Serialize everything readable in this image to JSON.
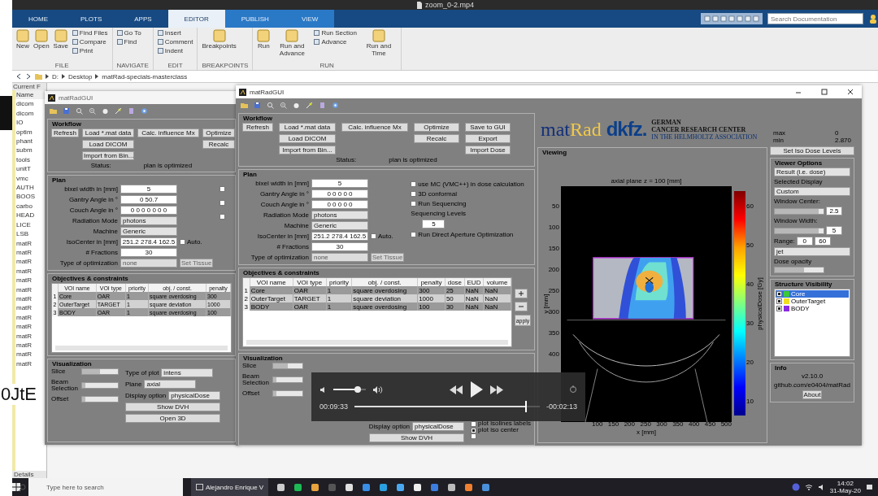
{
  "video_player": {
    "title": "zoom_0-2.mp4",
    "elapsed": "00:09:33",
    "remaining": "-00:02:13",
    "level": 0.93,
    "volume": {
      "level": 0.75
    }
  },
  "matlab": {
    "tabs": [
      {
        "label": "HOME",
        "selected": false
      },
      {
        "label": "PLOTS",
        "selected": false
      },
      {
        "label": "APPS",
        "selected": false
      },
      {
        "label": "EDITOR",
        "selected": true
      },
      {
        "label": "PUBLISH",
        "selected": false
      },
      {
        "label": "VIEW",
        "selected": false
      }
    ],
    "search": {
      "placeholder": "Search Documentation"
    },
    "ribbon": [
      {
        "label": "FILE",
        "items": [
          {
            "label": "New",
            "kind": "big"
          },
          {
            "label": "Open",
            "kind": "big"
          },
          {
            "label": "Save",
            "kind": "big"
          },
          {
            "label": "Find Files",
            "kind": "small"
          },
          {
            "label": "Compare",
            "kind": "small"
          },
          {
            "label": "Print",
            "kind": "small"
          }
        ]
      },
      {
        "label": "NAVIGATE",
        "items": [
          {
            "label": "Go To",
            "kind": "small"
          },
          {
            "label": "Find",
            "kind": "small"
          }
        ]
      },
      {
        "label": "EDIT",
        "items": [
          {
            "label": "Insert",
            "kind": "small"
          },
          {
            "label": "Comment",
            "kind": "small"
          },
          {
            "label": "Indent",
            "kind": "small"
          }
        ]
      },
      {
        "label": "BREAKPOINTS",
        "items": [
          {
            "label": "Breakpoints",
            "kind": "big"
          }
        ]
      },
      {
        "label": "RUN",
        "items": [
          {
            "label": "Run",
            "kind": "big"
          },
          {
            "label": "Run and Advance",
            "kind": "big"
          },
          {
            "label": "Run Section",
            "kind": "small"
          },
          {
            "label": "Advance",
            "kind": "small"
          },
          {
            "label": "Run and Time",
            "kind": "big"
          }
        ]
      }
    ],
    "path": [
      "D:",
      "Desktop",
      "matRad-specials-masterclass"
    ],
    "current_folder": {
      "title": "Current F",
      "items": [
        "Name",
        "dicom",
        "dicom",
        "IO",
        "optim",
        "phant",
        "subm",
        "tools",
        "unitT",
        "vmc",
        "AUTH",
        "BOOS",
        "carbo",
        "HEAD",
        "LICE",
        "LSB",
        "matR",
        "matR",
        "matR",
        "matR",
        "matR",
        "matR",
        "matR",
        "matR",
        "matR",
        "matR",
        "matR",
        "matR",
        "matR",
        "matR"
      ],
      "footer": "Details"
    },
    "side_text": "0JtE"
  },
  "background_gui": {
    "title": "matRadGUI",
    "workflow": {
      "title": "Workflow",
      "buttons": [
        "Refresh",
        "Load *.mat data",
        "Calc. influence Mx",
        "Optimize",
        "Load DICOM",
        "Recalc",
        "Import from Bin..."
      ],
      "status_label": "Status:",
      "status": "plan is optimized"
    },
    "plan": {
      "title": "Plan",
      "fields": [
        {
          "label": "bixel width in [mm]",
          "value": "5",
          "kind": "input"
        },
        {
          "label": "Gantry Angle in °",
          "value": "0 50.7",
          "kind": "input"
        },
        {
          "label": "Couch Angle in °",
          "value": "0 0 0 0 0 0 0",
          "kind": "input"
        },
        {
          "label": "Radiation Mode",
          "value": "photons",
          "kind": "popup"
        },
        {
          "label": "Machine",
          "value": "Generic",
          "kind": "popup"
        },
        {
          "label": "IsoCenter in [mm]",
          "value": "251.2 278.4 162.5",
          "kind": "input",
          "checkbox": {
            "label": "Auto.",
            "checked": false
          }
        },
        {
          "label": "# Fractions",
          "value": "30",
          "kind": "input"
        },
        {
          "label": "Type of optimization",
          "value": "none",
          "kind": "popup",
          "disabled": true,
          "button": {
            "label": "Set Tissue",
            "disabled": true
          }
        }
      ],
      "checks": [
        {
          "checked": false
        },
        {
          "checked": false
        },
        {
          "checked": false
        }
      ]
    },
    "objectives": {
      "title": "Objectives & constraints",
      "columns": [
        "",
        "VOI name",
        "VOI type",
        "priority",
        "obj. / const.",
        "penalty"
      ],
      "rows": [
        [
          "1",
          "Core",
          "OAR",
          "1",
          "square overdosing",
          "300"
        ],
        [
          "2",
          "OuterTarget",
          "TARGET",
          "1",
          "square deviation",
          "1000"
        ],
        [
          "3",
          "BODY",
          "OAR",
          "1",
          "square overdosing",
          "100"
        ]
      ]
    },
    "visualization": {
      "title": "Visualization",
      "sliders": [
        {
          "label": "Slice",
          "level": 0.5
        },
        {
          "label": "Beam Selection",
          "level": 0.1
        },
        {
          "label": "Offset",
          "level": 0.1
        }
      ],
      "popups": [
        {
          "label": "Type of plot",
          "value": "intens"
        },
        {
          "label": "Plane",
          "value": "axial"
        },
        {
          "label": "Display option",
          "value": "physicalDose"
        }
      ],
      "buttons": [
        "Show DVH",
        "Open 3D"
      ]
    }
  },
  "gui": {
    "title": "matRadGUI",
    "workflow": {
      "title": "Workflow",
      "buttons": [
        "Refresh",
        "Load *.mat data",
        "Calc. influence Mx",
        "Optimize",
        "Save to GUI",
        "Load DICOM",
        "Recalc",
        "Export",
        "Import from Bin...",
        "Import Dose"
      ],
      "status_label": "Status:",
      "status": "plan is optimized"
    },
    "plan": {
      "title": "Plan",
      "fields": [
        {
          "label": "bixel width in [mm]",
          "value": "5",
          "kind": "input"
        },
        {
          "label": "Gantry Angle in °",
          "value": "0 0 0 0 0",
          "kind": "input"
        },
        {
          "label": "Couch Angle in °",
          "value": "0 0 0 0 0",
          "kind": "input"
        },
        {
          "label": "Radiation Mode",
          "value": "photons",
          "kind": "popup"
        },
        {
          "label": "Machine",
          "value": "Generic",
          "kind": "popup"
        },
        {
          "label": "IsoCenter in [mm]",
          "value": "251.2 278.4 162.5",
          "kind": "input",
          "checkbox": {
            "label": "Auto.",
            "checked": false
          }
        },
        {
          "label": "# Fractions",
          "value": "30",
          "kind": "input"
        },
        {
          "label": "Type of optimization",
          "value": "none",
          "kind": "popup",
          "disabled": true,
          "button": {
            "label": "Set Tissue",
            "disabled": true
          }
        }
      ],
      "options": [
        {
          "kind": "checkbox",
          "label": "use MC (VMC++) in dose calculation",
          "checked": false
        },
        {
          "kind": "checkbox",
          "label": "3D conformal",
          "checked": false
        },
        {
          "kind": "checkbox",
          "label": "Run Sequencing",
          "checked": false
        },
        {
          "kind": "label",
          "label": "Sequencing Levels"
        },
        {
          "kind": "input",
          "value": "5"
        },
        {
          "kind": "checkbox",
          "label": "Run Direct Aperture Optimization",
          "checked": false
        }
      ]
    },
    "objectives": {
      "title": "Objectives & constraints",
      "columns": [
        "",
        "VOI name",
        "VOI type",
        "priority",
        "obj. / const.",
        "penalty",
        "dose",
        "EUD",
        "volume"
      ],
      "rows": [
        [
          "1",
          "Core",
          "OAR",
          "1",
          "square overdosing",
          "300",
          "25",
          "NaN",
          "NaN"
        ],
        [
          "2",
          "OuterTarget",
          "TARGET",
          "1",
          "square deviation",
          "1000",
          "50",
          "NaN",
          "NaN"
        ],
        [
          "3",
          "BODY",
          "OAR",
          "1",
          "square overdosing",
          "100",
          "30",
          "NaN",
          "NaN"
        ]
      ],
      "side_button": "apply"
    },
    "visualization": {
      "title": "Visualization",
      "sliders": [
        {
          "label": "Slice",
          "level": 0.5
        },
        {
          "label": "Beam Selection",
          "level": 0.1
        },
        {
          "label": "Offset",
          "level": 0.1
        }
      ],
      "popups": [
        {
          "label": "Display option",
          "value": "physicalDose"
        }
      ],
      "buttons": [
        "Show DVH"
      ],
      "checks": [
        {
          "label": "plot isolines labels",
          "checked": false
        },
        {
          "label": "plot iso center",
          "checked": true
        },
        {
          "checked": false
        }
      ]
    },
    "logo": {
      "mat": "mat",
      "rad": "Rad",
      "dkfz": "dkfz.",
      "lines": [
        "GERMAN",
        "CANCER RESEARCH CENTER",
        "IN THE HELMHOLTZ ASSOCIATION"
      ]
    },
    "viewing": {
      "title": "Viewing",
      "plot_title": "axial plane z = 100 [mm]",
      "ylabel": "y [mm]",
      "xlabel": "x [mm]",
      "yticks": [
        "50",
        "100",
        "150",
        "200",
        "250",
        "300",
        "350",
        "400"
      ],
      "xticks": [
        "100",
        "150",
        "200",
        "250",
        "300",
        "350",
        "400",
        "450",
        "500"
      ],
      "colorbar_ticks": [
        "60",
        "50",
        "40",
        "30",
        "20",
        "10"
      ],
      "colorbar_label": "physicalDose [Gy]"
    },
    "stats": [
      {
        "label": "max",
        "value": "0"
      },
      {
        "label": "min",
        "value": "2.870"
      }
    ],
    "iso_button": "Set Iso Dose Levels",
    "viewer_options": {
      "title": "Viewer Options",
      "display": "Result (i.e. dose)",
      "selected_label": "Selected Display",
      "custom": "Custom",
      "window_center": "Window Center:",
      "center_slider": {
        "level": 0.9
      },
      "center_value": "2.5",
      "window_width": "Window Width:",
      "width_slider": {
        "level": 0.9
      },
      "width_value": "5",
      "range_label": "Range:",
      "range_min": "0",
      "range_max": "60",
      "colormap": "jet",
      "opacity_label": "Dose opacity",
      "opacity_slider": {
        "level": 0.6
      }
    },
    "structures": {
      "title": "Structure Visibility",
      "items": [
        {
          "label": "Core",
          "checked": true,
          "selected": true,
          "color": "#3cc83c"
        },
        {
          "label": "OuterTarget",
          "checked": true,
          "selected": false,
          "color": "#f0e020"
        },
        {
          "label": "BODY",
          "checked": true,
          "selected": false,
          "color": "#8a2be2"
        }
      ]
    },
    "info": {
      "title": "Info",
      "version": "v2.10.0",
      "link": "github.com/e0404/matRad",
      "button": "About"
    }
  },
  "taskbar": {
    "search": {
      "placeholder": "Type here to search"
    },
    "app": "Alejandro Enrique V",
    "time": "14:02",
    "date": "31-May-20"
  }
}
